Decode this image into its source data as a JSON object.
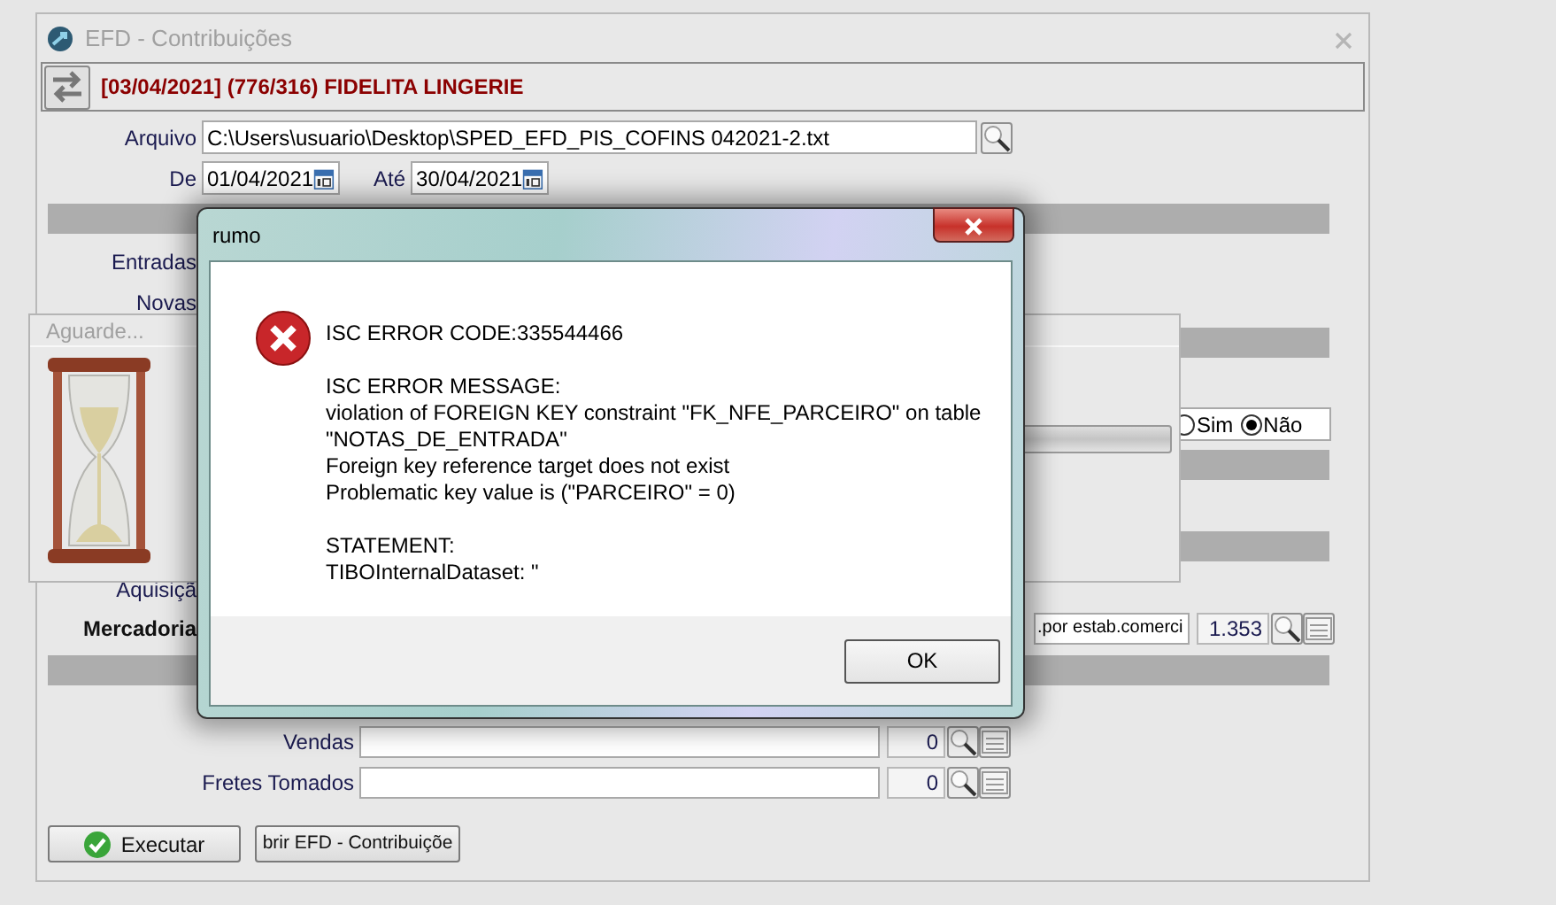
{
  "window": {
    "title": "EFD - Contribuições"
  },
  "header": {
    "title": "[03/04/2021] (776/316) FIDELITA LINGERIE"
  },
  "file": {
    "label": "Arquivo",
    "value": "C:\\Users\\usuario\\Desktop\\SPED_EFD_PIS_COFINS 042021-2.txt"
  },
  "period": {
    "from_label": "De",
    "from": "01/04/2021",
    "to_label": "Até",
    "to": "30/04/2021"
  },
  "section_labels": [
    "Entradas",
    "Novas"
  ],
  "radios": [
    {
      "label": "Sim",
      "selected": false
    },
    {
      "label": "Não",
      "selected": true
    }
  ],
  "acquisition_label": "Aquisiçã",
  "goods": {
    "label": "Mercadoria",
    "value": ".por estab.comerci",
    "count": "1.353"
  },
  "rows": [
    {
      "label": "Vendas",
      "count": "0"
    },
    {
      "label": "Fretes Tomados",
      "count": "0"
    }
  ],
  "buttons": [
    {
      "kind": "execute",
      "label": "Executar"
    },
    {
      "kind": "plain",
      "label": "brir EFD - Contribuiçõe"
    }
  ],
  "wait_dialog": {
    "title": "Aguarde..."
  },
  "error_dialog": {
    "title": "rumo",
    "blocks": [
      [
        "ISC ERROR CODE:335544466"
      ],
      [
        "ISC ERROR MESSAGE:",
        "violation of FOREIGN KEY constraint \"FK_NFE_PARCEIRO\" on table",
        "\"NOTAS_DE_ENTRADA\"",
        "Foreign key reference target does not exist",
        "Problematic key value is (\"PARCEIRO\" = 0)"
      ],
      [
        "STATEMENT:",
        "TIBOInternalDataset: \""
      ]
    ],
    "button": "OK"
  }
}
